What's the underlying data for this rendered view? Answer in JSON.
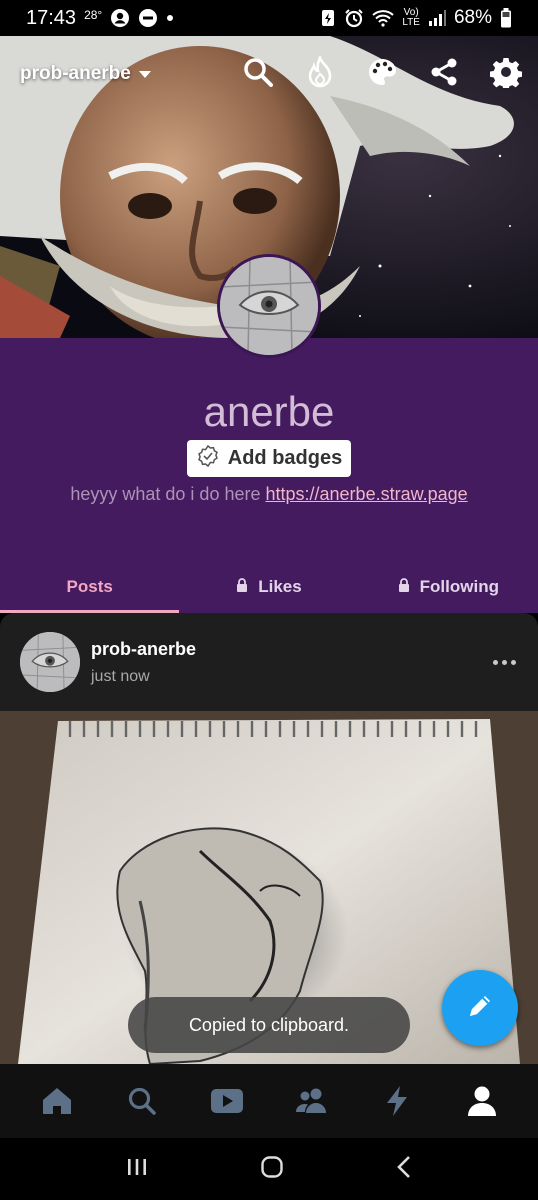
{
  "status_bar": {
    "time": "17:43",
    "temperature": "28°",
    "battery": "68%",
    "network_label": "LTE"
  },
  "header": {
    "blog_switcher_label": "prob-anerbe",
    "icons": [
      "search-icon",
      "fire-icon",
      "palette-icon",
      "share-icon",
      "gear-icon"
    ]
  },
  "profile": {
    "blog_name": "anerbe",
    "add_badges_label": "Add badges",
    "bio_text": "heyyy what do i do here",
    "bio_link": "https://anerbe.straw.page"
  },
  "tabs": [
    {
      "label": "Posts",
      "active": true,
      "locked": false
    },
    {
      "label": "Likes",
      "active": false,
      "locked": true
    },
    {
      "label": "Following",
      "active": false,
      "locked": true
    }
  ],
  "post": {
    "author": "prob-anerbe",
    "time": "just now"
  },
  "toast": {
    "text": "Copied to clipboard."
  },
  "bottom_nav": [
    "home-icon",
    "search-icon",
    "video-icon",
    "people-icon",
    "activity-icon",
    "account-icon"
  ],
  "colors": {
    "profile_bg": "#431b5e",
    "accent_tab": "#f3a7c2",
    "fab": "#1ca0f2",
    "blog_name": "#d3bcd6"
  }
}
